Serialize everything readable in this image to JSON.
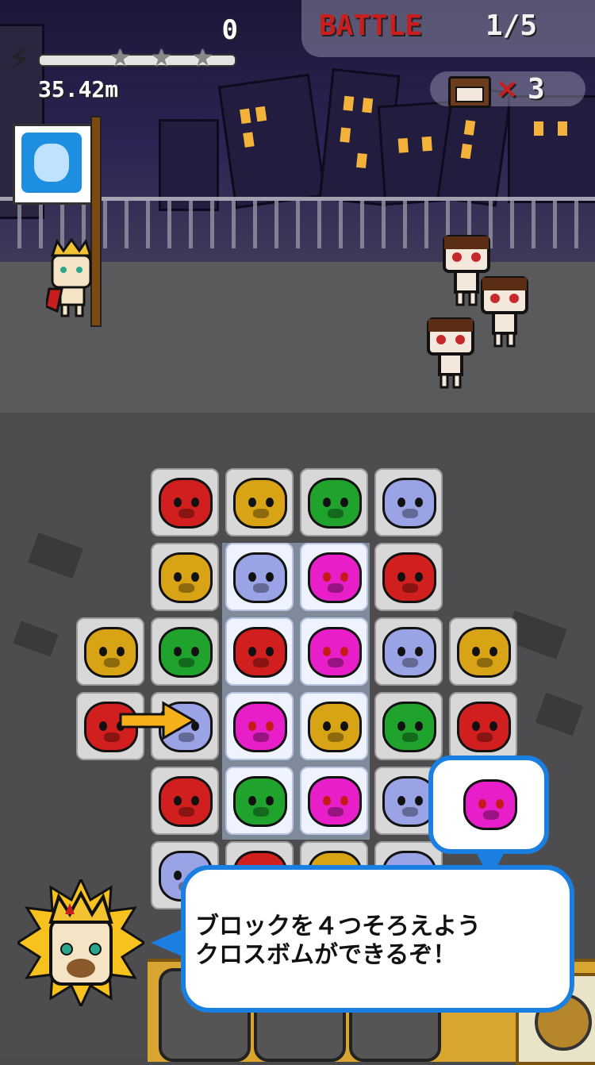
{
  "hud": {
    "score": "0",
    "battle_label": "BATTLE",
    "battle_progress": "1/5",
    "distance": "35.42m",
    "stars_earned": 0,
    "stars_total": 3,
    "enemy_multiplier": "×",
    "enemy_count": "3"
  },
  "board": {
    "rows": [
      [
        null,
        "dog",
        "bear",
        "pig",
        "cat",
        null
      ],
      [
        null,
        "bear",
        "cat",
        "rabbit",
        "dog",
        null
      ],
      [
        "bear",
        "pig",
        "dog",
        "rabbit",
        "cat",
        "bear"
      ],
      [
        "dog",
        "cat",
        "rabbit",
        "bear",
        "pig",
        "dog"
      ],
      [
        null,
        "dog",
        "pig",
        "rabbit",
        "cat",
        null
      ],
      [
        null,
        "cat",
        "dog",
        "bear",
        "cat",
        null
      ]
    ],
    "highlight": "column 2-3, rows 1-4",
    "hint_arrow": "arrow-right-icon"
  },
  "colors": {
    "dog": "#d11f1f",
    "bear": "#d9a316",
    "pig": "#1fa32c",
    "cat": "#9aa3e6",
    "rabbit": "#e81fc8",
    "bubble_border": "#1a7fe0",
    "battle_red": "#c81e1e"
  },
  "tutorial": {
    "message_line1": "ブロックを４つそろえよう",
    "message_line2": "クロスボムができるぞ！",
    "hint_piece": "rabbit"
  }
}
